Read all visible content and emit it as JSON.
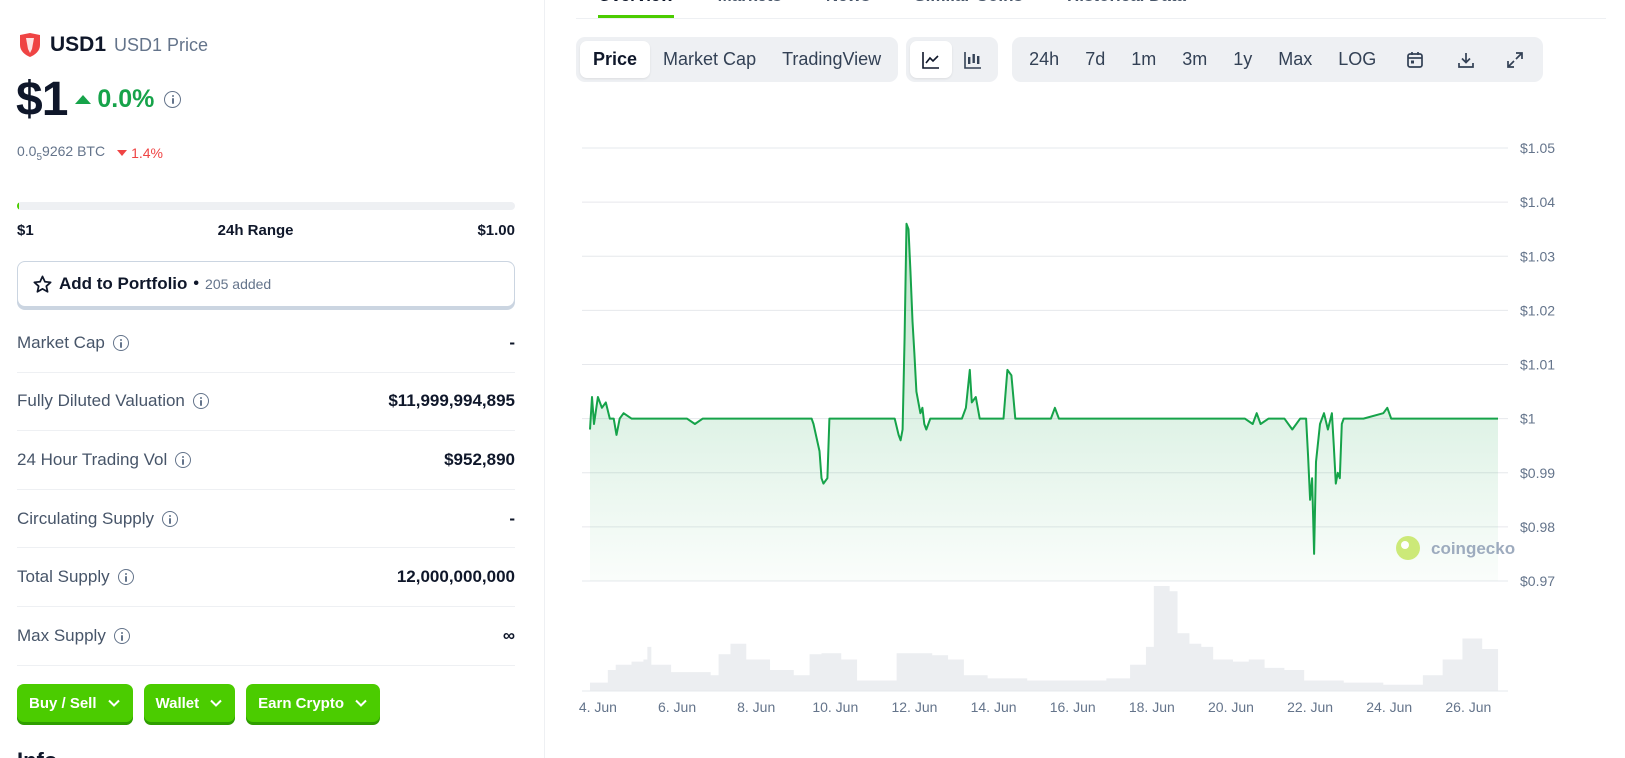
{
  "coin": {
    "symbol": "USD1",
    "name": "USD1 Price",
    "price": "$1",
    "change_24h": "0.0%",
    "btc_price_prefix": "0.0",
    "btc_price_sub": "5",
    "btc_price_suffix": "9262 BTC",
    "btc_change": "1.4%",
    "logo_color": "#ef4444"
  },
  "range": {
    "low": "$1",
    "label": "24h Range",
    "high": "$1.00",
    "fill_fraction": 0.004
  },
  "portfolio": {
    "label": "Add to Portfolio",
    "separator": "•",
    "count": "205 added"
  },
  "stats": [
    {
      "label": "Market Cap",
      "value": "-"
    },
    {
      "label": "Fully Diluted Valuation",
      "value": "$11,999,994,895"
    },
    {
      "label": "24 Hour Trading Vol",
      "value": "$952,890"
    },
    {
      "label": "Circulating Supply",
      "value": "-"
    },
    {
      "label": "Total Supply",
      "value": "12,000,000,000"
    },
    {
      "label": "Max Supply",
      "value": "∞"
    }
  ],
  "actions": [
    {
      "label": "Buy / Sell"
    },
    {
      "label": "Wallet"
    },
    {
      "label": "Earn Crypto"
    }
  ],
  "info_heading": "Info",
  "tabs": [
    "Overview",
    "Markets",
    "News",
    "Similar Coins",
    "Historical Data"
  ],
  "toolbar": {
    "data_tabs": [
      "Price",
      "Market Cap",
      "TradingView"
    ],
    "ranges": [
      "24h",
      "7d",
      "1m",
      "3m",
      "1y",
      "Max",
      "LOG"
    ]
  },
  "colors": {
    "accent": "#4bcc00",
    "up": "#16a34a",
    "down": "#ef4444",
    "line": "#16a34a",
    "volume": "#eceef1"
  },
  "chart_data": {
    "type": "line",
    "watermark": "coingecko",
    "ylim": [
      0.97,
      1.05
    ],
    "y_ticks": [
      "$1.05",
      "$1.04",
      "$1.03",
      "$1.02",
      "$1.01",
      "$1",
      "$0.99",
      "$0.98",
      "$0.97"
    ],
    "x_ticks": [
      "4. Jun",
      "6. Jun",
      "8. Jun",
      "10. Jun",
      "12. Jun",
      "14. Jun",
      "16. Jun",
      "18. Jun",
      "20. Jun",
      "22. Jun",
      "24. Jun",
      "26. Jun"
    ],
    "xlim": [
      3.95,
      27.0
    ],
    "grid": true,
    "series": [
      {
        "values": [
          [
            3.95,
            0.998
          ],
          [
            4.0,
            1.004
          ],
          [
            4.05,
            0.999
          ],
          [
            4.15,
            1.004
          ],
          [
            4.25,
            1.002
          ],
          [
            4.35,
            1.003
          ],
          [
            4.45,
            1.0
          ],
          [
            4.55,
            1.0
          ],
          [
            4.62,
            0.997
          ],
          [
            4.7,
            1.0
          ],
          [
            4.8,
            1.001
          ],
          [
            5.0,
            1.0
          ],
          [
            5.5,
            1.0
          ],
          [
            6.0,
            1.0
          ],
          [
            6.4,
            1.0
          ],
          [
            6.6,
            0.999
          ],
          [
            6.8,
            1.0
          ],
          [
            7.5,
            1.0
          ],
          [
            8.0,
            1.0
          ],
          [
            8.5,
            1.0
          ],
          [
            9.0,
            1.0
          ],
          [
            9.55,
            1.0
          ],
          [
            9.6,
            0.999
          ],
          [
            9.75,
            0.994
          ],
          [
            9.8,
            0.989
          ],
          [
            9.85,
            0.988
          ],
          [
            9.95,
            0.989
          ],
          [
            10.0,
            1.0
          ],
          [
            10.5,
            1.0
          ],
          [
            11.0,
            1.0
          ],
          [
            11.5,
            1.0
          ],
          [
            11.65,
            1.0
          ],
          [
            11.75,
            0.997
          ],
          [
            11.8,
            0.996
          ],
          [
            11.85,
            0.998
          ],
          [
            11.9,
            1.015
          ],
          [
            11.95,
            1.036
          ],
          [
            12.0,
            1.035
          ],
          [
            12.05,
            1.027
          ],
          [
            12.1,
            1.018
          ],
          [
            12.15,
            1.012
          ],
          [
            12.2,
            1.005
          ],
          [
            12.25,
            1.003
          ],
          [
            12.3,
            1.001
          ],
          [
            12.35,
            1.002
          ],
          [
            12.4,
            0.999
          ],
          [
            12.45,
            0.998
          ],
          [
            12.55,
            1.0
          ],
          [
            13.0,
            1.0
          ],
          [
            13.35,
            1.0
          ],
          [
            13.45,
            1.002
          ],
          [
            13.55,
            1.009
          ],
          [
            13.6,
            1.003
          ],
          [
            13.7,
            1.004
          ],
          [
            13.8,
            1.0
          ],
          [
            14.0,
            1.0
          ],
          [
            14.4,
            1.0
          ],
          [
            14.5,
            1.009
          ],
          [
            14.6,
            1.008
          ],
          [
            14.7,
            1.0
          ],
          [
            15.0,
            1.0
          ],
          [
            15.6,
            1.0
          ],
          [
            15.7,
            1.002
          ],
          [
            15.8,
            1.0
          ],
          [
            16.5,
            1.0
          ],
          [
            17.0,
            1.0
          ],
          [
            18.0,
            1.0
          ],
          [
            19.0,
            1.0
          ],
          [
            20.0,
            1.0
          ],
          [
            20.5,
            1.0
          ],
          [
            20.7,
            0.999
          ],
          [
            20.8,
            1.001
          ],
          [
            20.9,
            0.999
          ],
          [
            21.1,
            1.0
          ],
          [
            21.5,
            1.0
          ],
          [
            21.7,
            0.998
          ],
          [
            21.9,
            1.0
          ],
          [
            22.05,
            1.0
          ],
          [
            22.1,
            0.993
          ],
          [
            22.15,
            0.985
          ],
          [
            22.2,
            0.989
          ],
          [
            22.25,
            0.975
          ],
          [
            22.3,
            0.992
          ],
          [
            22.4,
            0.999
          ],
          [
            22.5,
            1.001
          ],
          [
            22.6,
            0.998
          ],
          [
            22.7,
            1.001
          ],
          [
            22.75,
            0.995
          ],
          [
            22.8,
            0.988
          ],
          [
            22.85,
            0.99
          ],
          [
            22.9,
            0.989
          ],
          [
            22.95,
            0.999
          ],
          [
            23.0,
            1.0
          ],
          [
            23.5,
            1.0
          ],
          [
            24.0,
            1.001
          ],
          [
            24.1,
            1.002
          ],
          [
            24.2,
            1.0
          ],
          [
            25.0,
            1.0
          ],
          [
            26.0,
            1.0
          ],
          [
            26.5,
            1.0
          ],
          [
            26.9,
            1.0
          ]
        ]
      }
    ],
    "volume": [
      [
        3.95,
        0.08
      ],
      [
        4.4,
        0.2
      ],
      [
        4.6,
        0.25
      ],
      [
        5.0,
        0.28
      ],
      [
        5.3,
        0.3
      ],
      [
        5.4,
        0.42
      ],
      [
        5.5,
        0.25
      ],
      [
        6.0,
        0.18
      ],
      [
        7.0,
        0.15
      ],
      [
        7.2,
        0.35
      ],
      [
        7.5,
        0.45
      ],
      [
        7.9,
        0.3
      ],
      [
        8.5,
        0.2
      ],
      [
        9.1,
        0.15
      ],
      [
        9.5,
        0.35
      ],
      [
        9.8,
        0.36
      ],
      [
        10.3,
        0.3
      ],
      [
        10.7,
        0.1
      ],
      [
        11.2,
        0.1
      ],
      [
        11.7,
        0.36
      ],
      [
        12.1,
        0.36
      ],
      [
        12.6,
        0.34
      ],
      [
        13.0,
        0.3
      ],
      [
        13.4,
        0.15
      ],
      [
        14.0,
        0.12
      ],
      [
        15.0,
        0.1
      ],
      [
        16.0,
        0.1
      ],
      [
        17.0,
        0.12
      ],
      [
        17.6,
        0.25
      ],
      [
        18.0,
        0.42
      ],
      [
        18.2,
        1.0
      ],
      [
        18.6,
        0.95
      ],
      [
        18.8,
        0.55
      ],
      [
        19.1,
        0.45
      ],
      [
        19.4,
        0.42
      ],
      [
        19.7,
        0.3
      ],
      [
        20.2,
        0.28
      ],
      [
        20.6,
        0.3
      ],
      [
        21.0,
        0.22
      ],
      [
        21.5,
        0.2
      ],
      [
        22.0,
        0.1
      ],
      [
        23.0,
        0.08
      ],
      [
        24.0,
        0.06
      ],
      [
        25.0,
        0.15
      ],
      [
        25.5,
        0.3
      ],
      [
        26.0,
        0.5
      ],
      [
        26.5,
        0.4
      ],
      [
        26.9,
        0.1
      ]
    ]
  }
}
